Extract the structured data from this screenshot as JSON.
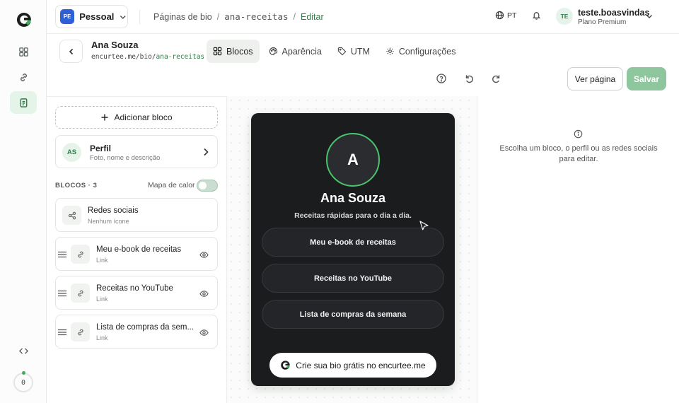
{
  "workspace": {
    "badge": "PE",
    "name": "Pessoal"
  },
  "breadcrumbs": {
    "root": "Páginas de bio",
    "slug": "ana-receitas",
    "current": "Editar"
  },
  "header": {
    "language": "PT",
    "user_initials": "TE",
    "user_name": "teste.boasvindas",
    "user_plan": "Plano Premium"
  },
  "page": {
    "name": "Ana Souza",
    "url_prefix": "encurtee.me/bio/",
    "url_slug": "ana-receitas"
  },
  "tabs": [
    {
      "label": "Blocos",
      "icon": "grid-icon",
      "active": true
    },
    {
      "label": "Aparência",
      "icon": "palette-icon",
      "active": false
    },
    {
      "label": "UTM",
      "icon": "tag-icon",
      "active": false
    },
    {
      "label": "Configurações",
      "icon": "gear-icon",
      "active": false
    }
  ],
  "actions": {
    "view": "Ver página",
    "save": "Salvar"
  },
  "rail": {
    "counter": "0"
  },
  "editor": {
    "add_block": "Adicionar bloco",
    "profile": {
      "initials": "AS",
      "title": "Perfil",
      "subtitle": "Foto, nome e descrição"
    },
    "blocks_header": "BLOCOS · 3",
    "heatmap_label": "Mapa de calor",
    "heatmap_on": false,
    "social": {
      "title": "Redes sociais",
      "subtitle": "Nenhum ícone"
    },
    "links": [
      {
        "title": "Meu e-book de receitas",
        "type": "Link"
      },
      {
        "title": "Receitas no YouTube",
        "type": "Link"
      },
      {
        "title": "Lista de compras da sem...",
        "type": "Link"
      }
    ]
  },
  "preview": {
    "avatar_letter": "A",
    "name": "Ana Souza",
    "description": "Receitas rápidas para o dia a dia.",
    "links": [
      "Meu e-book de receitas",
      "Receitas no YouTube",
      "Lista de compras da semana"
    ],
    "cta": "Crie sua bio grátis no encurtee.me",
    "accent": "#49c46e",
    "background": "#1b1c1e"
  },
  "inspector": {
    "message": "Escolha um bloco, o perfil ou as redes sociais para editar."
  },
  "colors": {
    "brand_green": "#2f7d46",
    "save_disabled": "#8ec79d",
    "workspace_badge": "#2f5fd6"
  }
}
